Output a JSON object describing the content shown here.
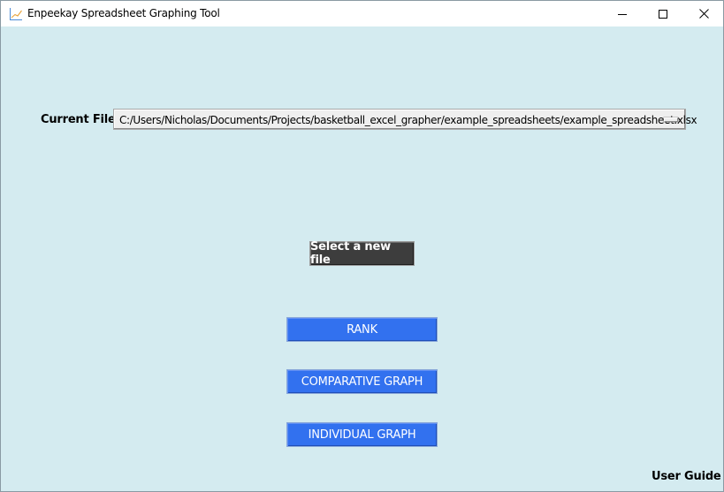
{
  "window": {
    "title": "Enpeekay Spreadsheet Graphing Tool",
    "app_icon": "chart-line-icon",
    "controls": {
      "minimize_icon": "minimize-icon",
      "maximize_icon": "maximize-icon",
      "close_icon": "close-icon"
    }
  },
  "file": {
    "label": "Current File:",
    "path": "C:/Users/Nicholas/Documents/Projects/basketball_excel_grapher/example_spreadsheets/example_spreadsheet.xlsx"
  },
  "buttons": {
    "select_file": "Select a new file",
    "rank": "RANK",
    "comparative": "COMPARATIVE GRAPH",
    "individual": "INDIVIDUAL GRAPH"
  },
  "footer": {
    "user_guide": "User Guide"
  },
  "colors": {
    "background": "#d4ebf0",
    "action_button": "#3271ef",
    "select_button": "#3d3d3d",
    "text_on_button": "#ffffff"
  }
}
